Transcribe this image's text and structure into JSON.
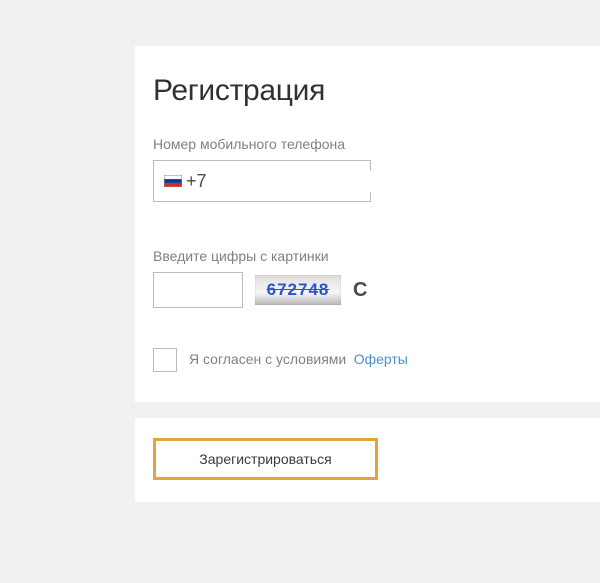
{
  "title": "Регистрация",
  "phone": {
    "label": "Номер мобильного телефона",
    "prefix": "+7",
    "value": ""
  },
  "captcha": {
    "label": "Введите цифры с картинки",
    "image_text": "672748",
    "value": ""
  },
  "agreement": {
    "text": "Я согласен с условиями",
    "offer_link": "Оферты",
    "checked": false
  },
  "register_button": "Зарегистрироваться"
}
